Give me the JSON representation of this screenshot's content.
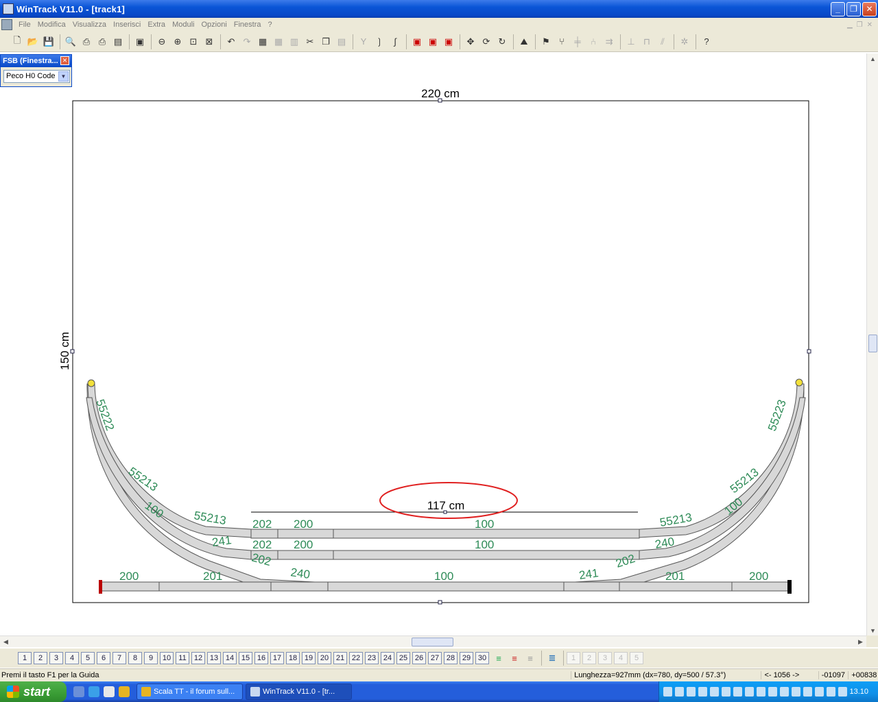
{
  "window": {
    "title": "WinTrack  V11.0 - [track1]",
    "minimize": "_",
    "maximize": "❐",
    "close": "✕"
  },
  "menu": [
    "File",
    "Modifica",
    "Visualizza",
    "Inserisci",
    "Extra",
    "Moduli",
    "Opzioni",
    "Finestra",
    "?"
  ],
  "toolbar_icons": [
    "new-document-icon",
    "open-folder-icon",
    "save-icon",
    "|",
    "print-preview-icon",
    "print-icon",
    "print-setup-icon",
    "page-icon",
    "|",
    "image-icon",
    "|",
    "zoom-out-icon",
    "zoom-in-icon",
    "zoom-window-icon",
    "zoom-all-icon",
    "|",
    "undo-icon",
    "redo-icon",
    "properties-icon",
    "grid-icon",
    "table-icon",
    "cut-icon",
    "copy-icon",
    "paste-icon",
    "|",
    "turnout-icon",
    "curve-icon",
    "flex-track-icon",
    "|",
    "layer-red-icon",
    "layer-red2-icon",
    "layer-red3-icon",
    "|",
    "move-icon",
    "rotate-icon",
    "rotate-180-icon",
    "|",
    "terrain-icon",
    "|",
    "signal-icon",
    "switch-icon",
    "line-icon",
    "branch-icon",
    "junction-icon",
    "|",
    "align-icon",
    "connect-icon",
    "parallel-icon",
    "|",
    "settings-icon",
    "|",
    "help-icon"
  ],
  "fsb": {
    "title": "FSB (Finestra...",
    "close": "✕",
    "catalog": "Peco H0 Code",
    "dropdown": "▼"
  },
  "drawing": {
    "width_label": "220 cm",
    "height_label": "150 cm",
    "measure_label": "117 cm",
    "track_labels": {
      "left_inner_top": "55222",
      "right_inner_top": "55223",
      "left_curve_1": "55213",
      "left_curve_2": "55213",
      "left_curve_3": "100",
      "right_curve_1": "55213",
      "right_curve_2": "55213",
      "right_curve_3": "100",
      "row1_202": "202",
      "row1_200": "200",
      "row1_100": "100",
      "row2_202": "202",
      "row2_200": "200",
      "row2_100": "100",
      "left_241": "241",
      "left_202": "202",
      "left_240": "240",
      "right_240": "240",
      "right_202": "202",
      "right_241": "241",
      "row3_200_left": "200",
      "row3_201_left": "201",
      "row3_100": "100",
      "row3_201_right": "201",
      "row3_200_right": "200"
    }
  },
  "layers": [
    "1",
    "2",
    "3",
    "4",
    "5",
    "6",
    "7",
    "8",
    "9",
    "10",
    "11",
    "12",
    "13",
    "14",
    "15",
    "16",
    "17",
    "18",
    "19",
    "20",
    "21",
    "22",
    "23",
    "24",
    "25",
    "26",
    "27",
    "28",
    "29",
    "30"
  ],
  "layer_extra": [
    "1",
    "2",
    "3",
    "4",
    "5"
  ],
  "status": {
    "help": "Premi il tasto F1 per la Guida",
    "length": "Lunghezza=927mm (dx=780, dy=500 / 57.3°)",
    "pos": "<- 1056 ->",
    "x": "-01097",
    "y": "+00838"
  },
  "taskbar": {
    "start": "start",
    "tasks": [
      "Scala TT - il forum sull...",
      "WinTrack  V11.0 - [tr..."
    ],
    "clock": "13.10"
  },
  "colors": {
    "track_label": "#2e8b57",
    "highlight_ellipse": "#e02020",
    "rail_fill": "#d8d8d8"
  }
}
